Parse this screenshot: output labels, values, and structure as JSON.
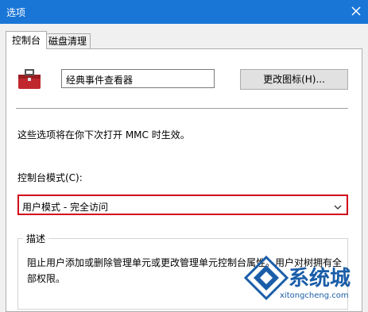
{
  "window": {
    "title": "选项"
  },
  "tabs": {
    "active": "控制台",
    "inactive": "磁盘清理"
  },
  "console": {
    "name_value": "经典事件查看器",
    "change_icon_button": "更改图标(H)..."
  },
  "info_text": "这些选项将在你下次打开 MMC 时生效。",
  "mode": {
    "label": "控制台模式(C):",
    "selected": "用户模式 - 完全访问"
  },
  "description": {
    "legend": "描述",
    "text": "阻止用户添加或删除管理单元或更改管理单元控制台属性。用户对树拥有全部权限。"
  },
  "watermark": {
    "name": "系统城",
    "url": "xitongcheng.com"
  },
  "colors": {
    "titlebar": "#1976d7",
    "highlight_border": "#d0021b",
    "watermark": "#1a5da8"
  },
  "icons": {
    "app": "toolbox-icon",
    "close": "close-icon",
    "dropdown": "chevron-down-icon"
  }
}
